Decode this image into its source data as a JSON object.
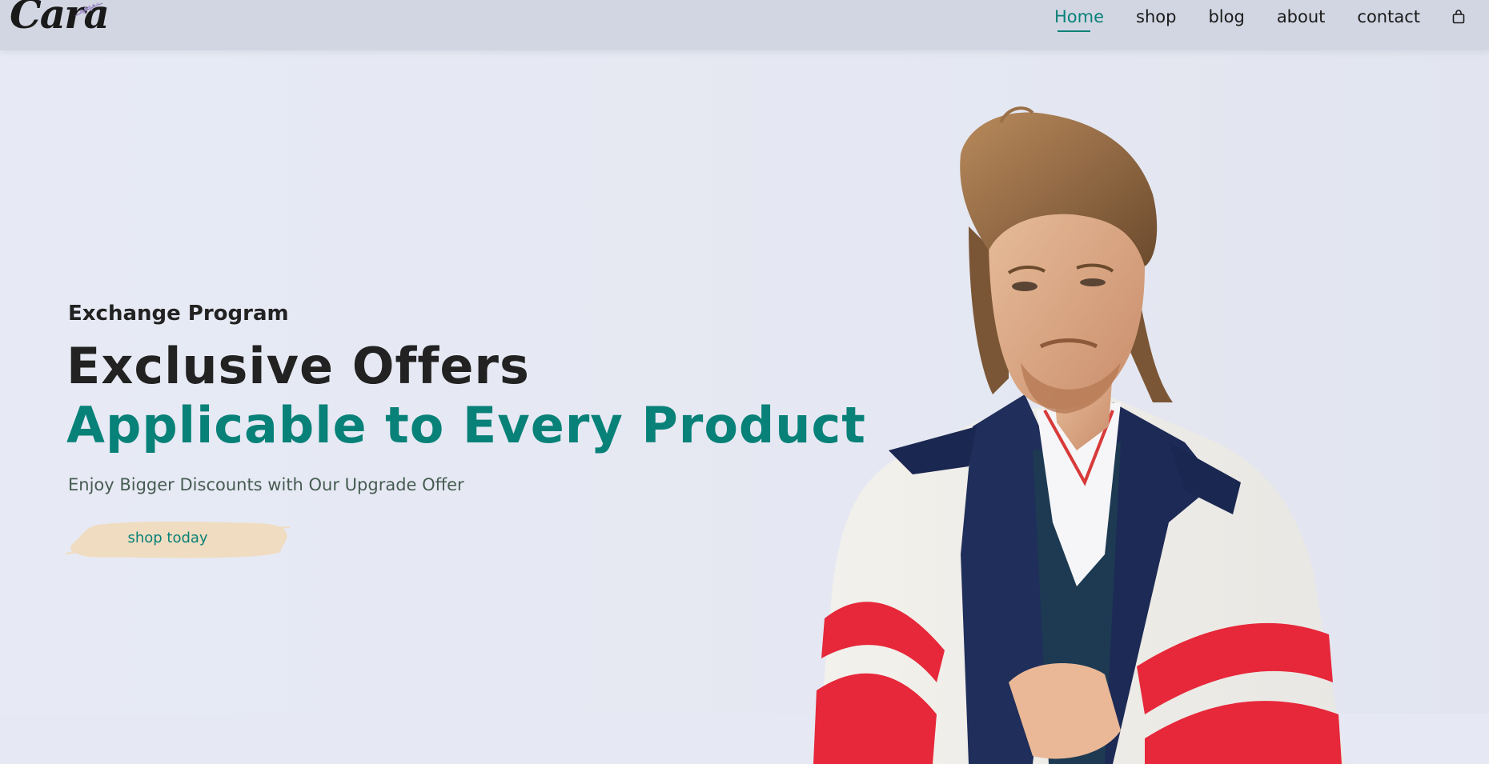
{
  "header": {
    "logo": "Cara",
    "nav": [
      {
        "label": "Home",
        "active": true
      },
      {
        "label": "shop",
        "active": false
      },
      {
        "label": "blog",
        "active": false
      },
      {
        "label": "about",
        "active": false
      },
      {
        "label": "contact",
        "active": false
      }
    ],
    "cart_icon": "shopping-bag-icon"
  },
  "hero": {
    "subtitle": "Exchange Program",
    "title": "Exclusive Offers",
    "title_highlight": "Applicable to Every Product",
    "description": "Enjoy Bigger Discounts with Our Upgrade Offer",
    "cta_label": "shop today"
  },
  "colors": {
    "accent": "#088178",
    "header_bg": "#d2d6e2",
    "hero_bg": "#e6e9f3",
    "button_bg": "#f0dcc0"
  }
}
